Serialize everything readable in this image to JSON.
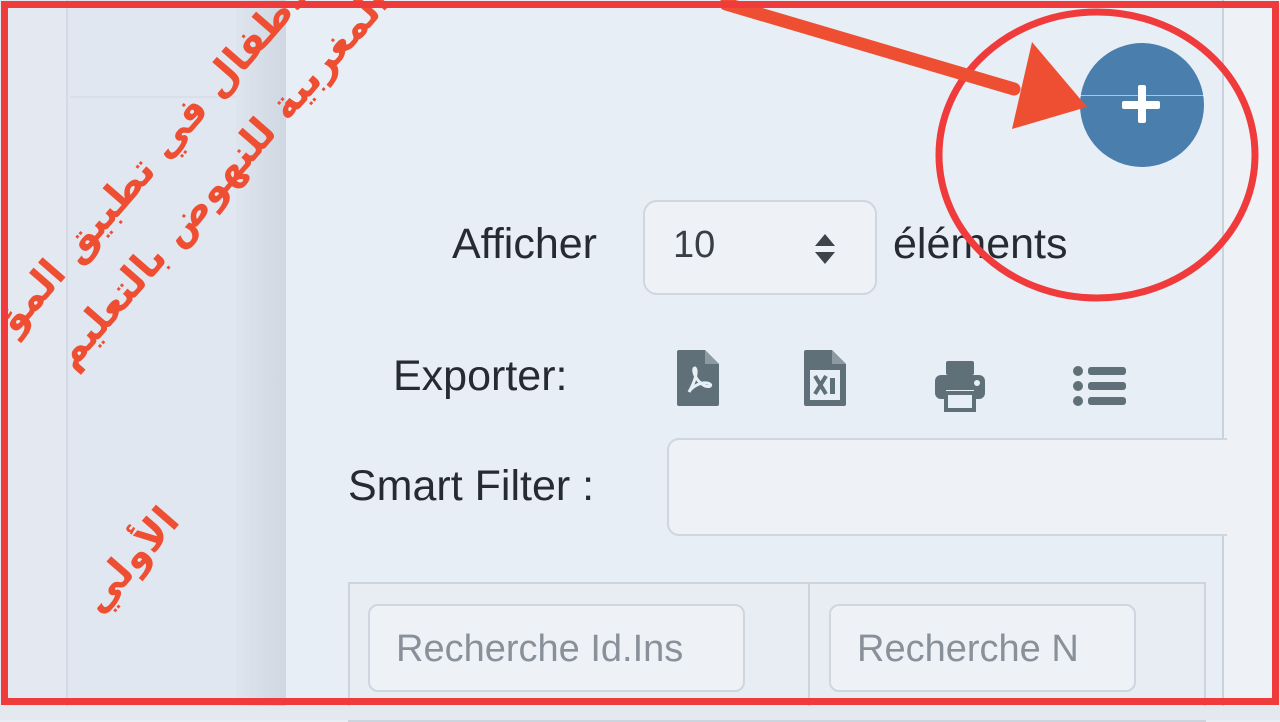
{
  "table_controls": {
    "show_label": "Afficher",
    "page_size": "10",
    "elements_label": "éléments",
    "export_label": "Exporter:",
    "export_icons": [
      "pdf-icon",
      "excel-icon",
      "print-icon",
      "columns-icon"
    ],
    "smart_filter_label": "Smart Filter :",
    "smart_filter_value": ""
  },
  "table": {
    "column_search_placeholders": [
      "Recherche Id.Ins",
      "Recherche N"
    ]
  },
  "add_button": {
    "icon": "plus-icon",
    "color": "#4a7fad"
  },
  "overlay": {
    "color": "#ef3b3b",
    "arabic_lines": [
      "طريقة تسجيل الأطفال في تطبيق المؤ",
      "سسة المغربية للنهوض بالتعليم",
      "الأولي"
    ]
  }
}
